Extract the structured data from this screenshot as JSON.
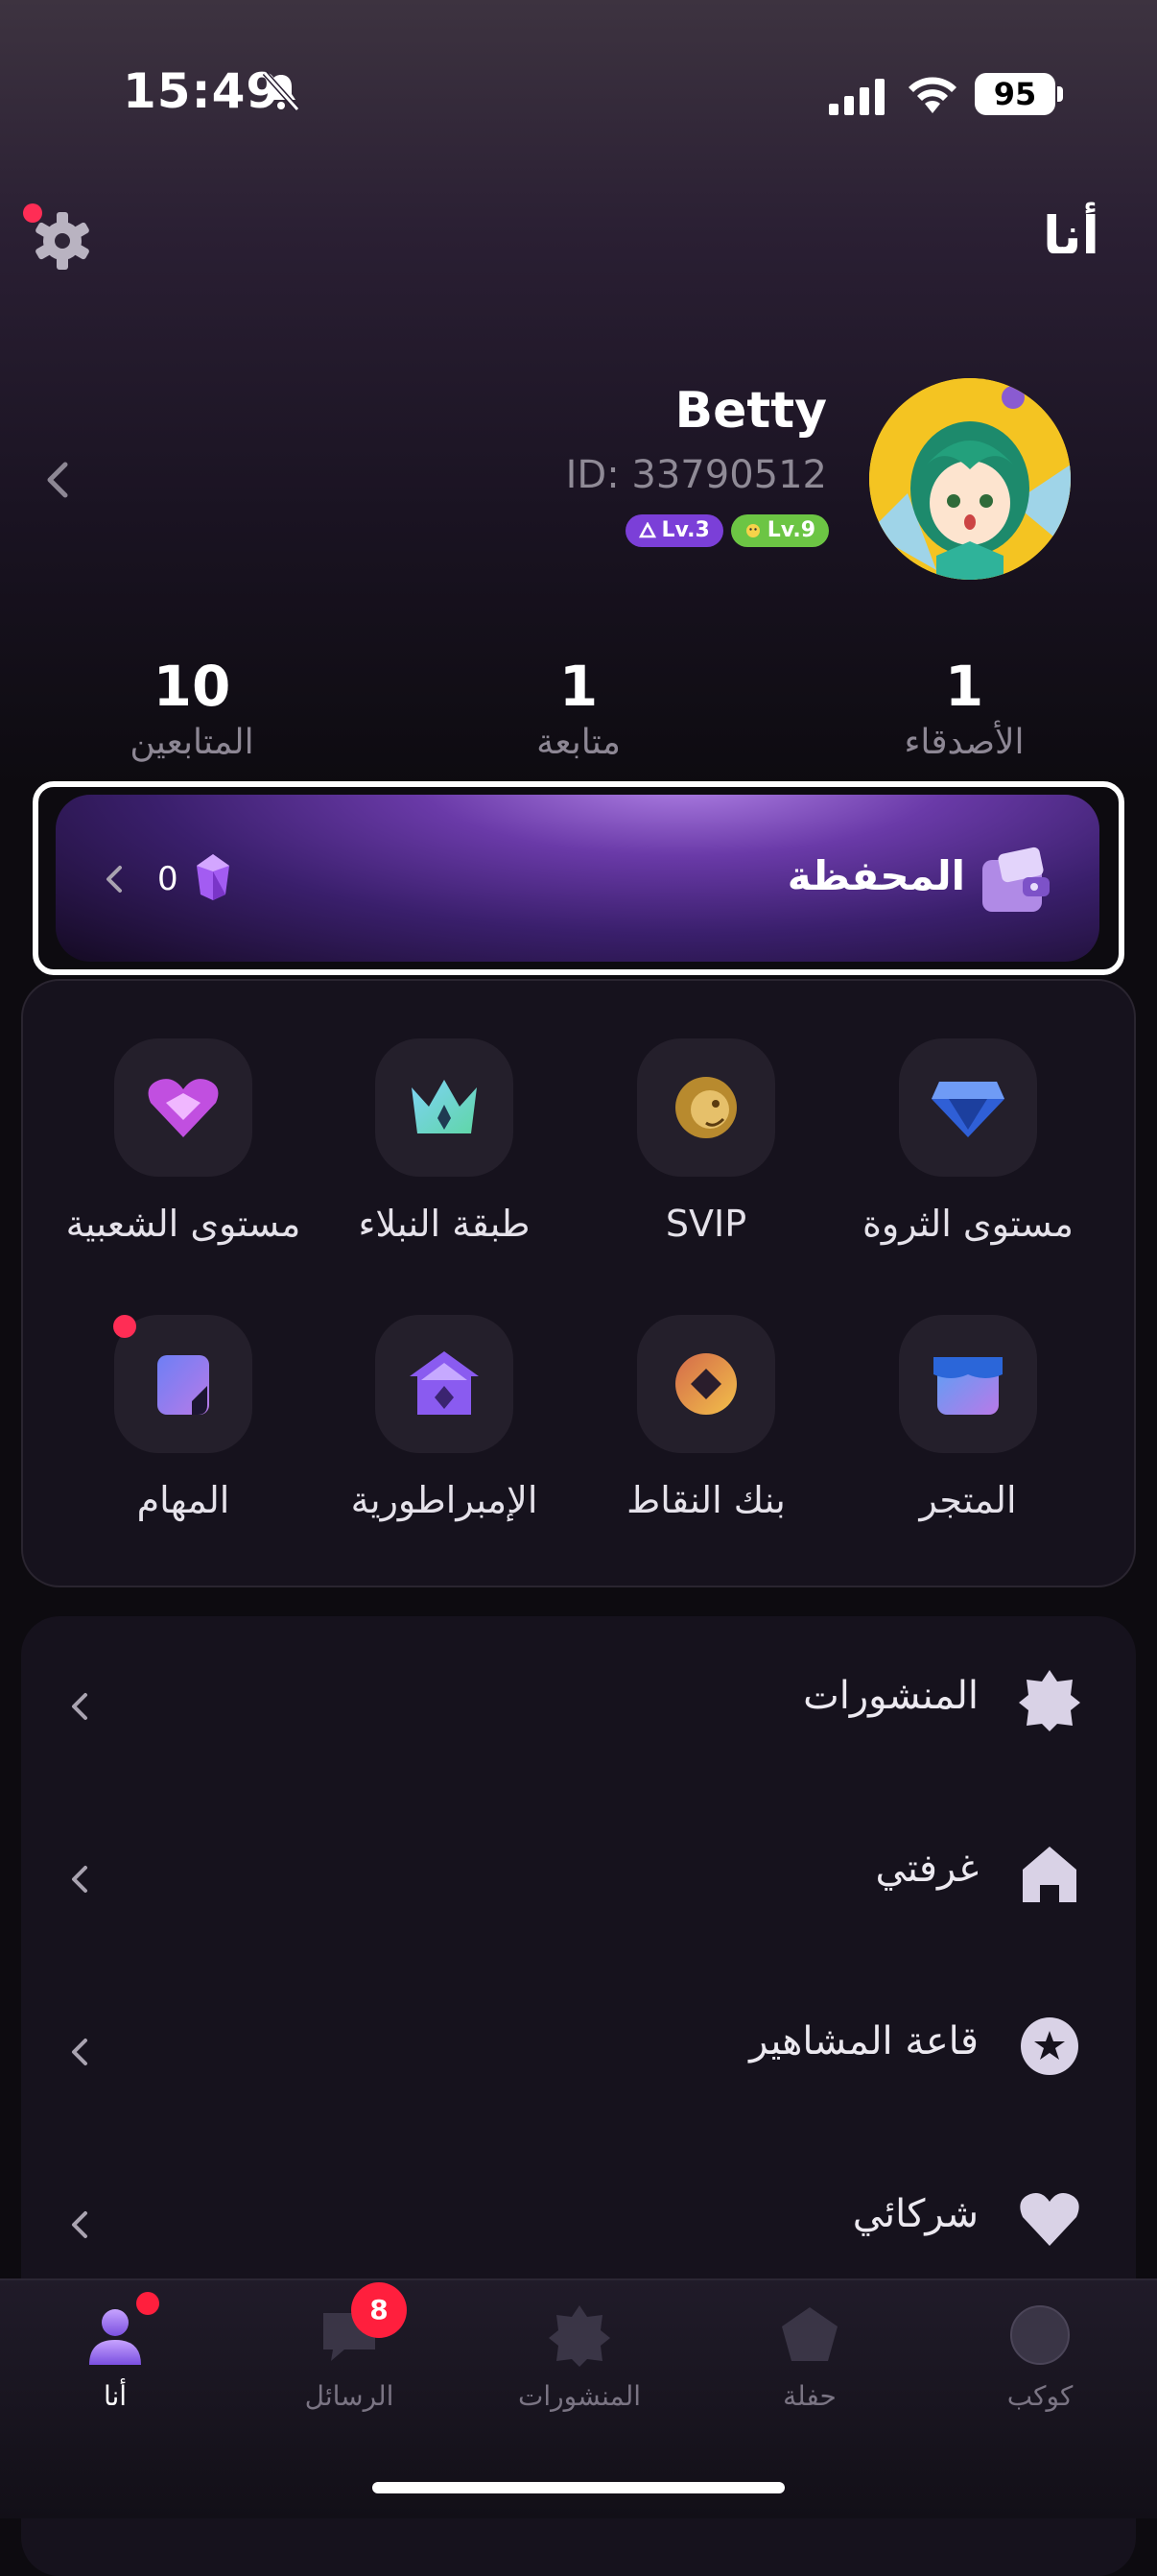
{
  "status_bar": {
    "time": "15:49",
    "battery": "95"
  },
  "header": {
    "title": "أنا"
  },
  "profile": {
    "name": "Betty",
    "id": "ID: 33790512",
    "badges": [
      "Lv.3",
      "Lv.9"
    ]
  },
  "stats": [
    {
      "value": "10",
      "label": "المتابعين"
    },
    {
      "value": "1",
      "label": "متابعة"
    },
    {
      "value": "1",
      "label": "الأصدقاء"
    }
  ],
  "wallet": {
    "title": "المحفظة",
    "balance": "0"
  },
  "features": [
    {
      "label": "مستوى الثروة",
      "icon": "diamond-icon"
    },
    {
      "label": "SVIP",
      "icon": "lion-icon"
    },
    {
      "label": "طبقة النبلاء",
      "icon": "crown-icon"
    },
    {
      "label": "مستوى الشعبية",
      "icon": "heart-badge-icon"
    },
    {
      "label": "المتجر",
      "icon": "store-icon"
    },
    {
      "label": "بنك النقاط",
      "icon": "points-coin-icon"
    },
    {
      "label": "الإمبراطورية",
      "icon": "empire-icon"
    },
    {
      "label": "المهام",
      "icon": "tasks-icon"
    }
  ],
  "menu": [
    {
      "label": "المنشورات",
      "icon": "star-badge-icon"
    },
    {
      "label": "غرفتي",
      "icon": "home-icon"
    },
    {
      "label": "قاعة المشاهير",
      "icon": "star-circle-icon"
    },
    {
      "label": "شركائي",
      "icon": "heart-icon"
    }
  ],
  "tabs": [
    {
      "label": "كوكب",
      "icon": "planet-icon"
    },
    {
      "label": "حفلة",
      "icon": "party-icon"
    },
    {
      "label": "المنشورات",
      "icon": "posts-icon"
    },
    {
      "label": "الرسائل",
      "icon": "messages-icon",
      "badge": "8"
    },
    {
      "label": "أنا",
      "icon": "profile-icon"
    }
  ],
  "colors": {
    "accent": "#7b3fd8",
    "notification": "#ff2d55",
    "background": "#0d0b10"
  }
}
